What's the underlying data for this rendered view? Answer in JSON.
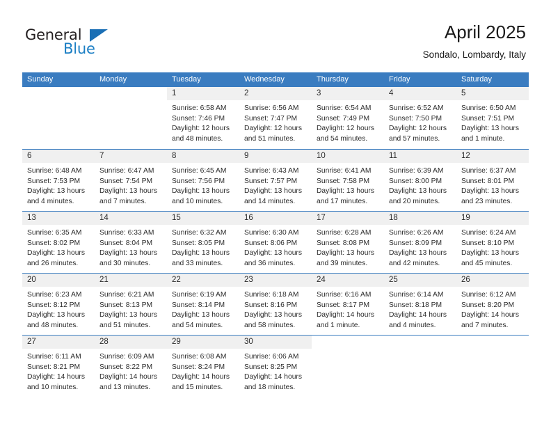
{
  "brand": {
    "name_part1": "General",
    "name_part2": "Blue",
    "color_dark": "#231f20",
    "color_blue": "#1c7fc4"
  },
  "header": {
    "title": "April 2025",
    "subtitle": "Sondalo, Lombardy, Italy"
  },
  "theme": {
    "header_bar": "#3a7cc0",
    "daynum_band": "#f0f0f0",
    "text": "#2b2b2b"
  },
  "weekdays": [
    "Sunday",
    "Monday",
    "Tuesday",
    "Wednesday",
    "Thursday",
    "Friday",
    "Saturday"
  ],
  "weeks": [
    [
      {
        "day": "",
        "lines": [
          "",
          "",
          "",
          ""
        ]
      },
      {
        "day": "",
        "lines": [
          "",
          "",
          "",
          ""
        ]
      },
      {
        "day": "1",
        "lines": [
          "Sunrise: 6:58 AM",
          "Sunset: 7:46 PM",
          "Daylight: 12 hours",
          "and 48 minutes."
        ]
      },
      {
        "day": "2",
        "lines": [
          "Sunrise: 6:56 AM",
          "Sunset: 7:47 PM",
          "Daylight: 12 hours",
          "and 51 minutes."
        ]
      },
      {
        "day": "3",
        "lines": [
          "Sunrise: 6:54 AM",
          "Sunset: 7:49 PM",
          "Daylight: 12 hours",
          "and 54 minutes."
        ]
      },
      {
        "day": "4",
        "lines": [
          "Sunrise: 6:52 AM",
          "Sunset: 7:50 PM",
          "Daylight: 12 hours",
          "and 57 minutes."
        ]
      },
      {
        "day": "5",
        "lines": [
          "Sunrise: 6:50 AM",
          "Sunset: 7:51 PM",
          "Daylight: 13 hours",
          "and 1 minute."
        ]
      }
    ],
    [
      {
        "day": "6",
        "lines": [
          "Sunrise: 6:48 AM",
          "Sunset: 7:53 PM",
          "Daylight: 13 hours",
          "and 4 minutes."
        ]
      },
      {
        "day": "7",
        "lines": [
          "Sunrise: 6:47 AM",
          "Sunset: 7:54 PM",
          "Daylight: 13 hours",
          "and 7 minutes."
        ]
      },
      {
        "day": "8",
        "lines": [
          "Sunrise: 6:45 AM",
          "Sunset: 7:56 PM",
          "Daylight: 13 hours",
          "and 10 minutes."
        ]
      },
      {
        "day": "9",
        "lines": [
          "Sunrise: 6:43 AM",
          "Sunset: 7:57 PM",
          "Daylight: 13 hours",
          "and 14 minutes."
        ]
      },
      {
        "day": "10",
        "lines": [
          "Sunrise: 6:41 AM",
          "Sunset: 7:58 PM",
          "Daylight: 13 hours",
          "and 17 minutes."
        ]
      },
      {
        "day": "11",
        "lines": [
          "Sunrise: 6:39 AM",
          "Sunset: 8:00 PM",
          "Daylight: 13 hours",
          "and 20 minutes."
        ]
      },
      {
        "day": "12",
        "lines": [
          "Sunrise: 6:37 AM",
          "Sunset: 8:01 PM",
          "Daylight: 13 hours",
          "and 23 minutes."
        ]
      }
    ],
    [
      {
        "day": "13",
        "lines": [
          "Sunrise: 6:35 AM",
          "Sunset: 8:02 PM",
          "Daylight: 13 hours",
          "and 26 minutes."
        ]
      },
      {
        "day": "14",
        "lines": [
          "Sunrise: 6:33 AM",
          "Sunset: 8:04 PM",
          "Daylight: 13 hours",
          "and 30 minutes."
        ]
      },
      {
        "day": "15",
        "lines": [
          "Sunrise: 6:32 AM",
          "Sunset: 8:05 PM",
          "Daylight: 13 hours",
          "and 33 minutes."
        ]
      },
      {
        "day": "16",
        "lines": [
          "Sunrise: 6:30 AM",
          "Sunset: 8:06 PM",
          "Daylight: 13 hours",
          "and 36 minutes."
        ]
      },
      {
        "day": "17",
        "lines": [
          "Sunrise: 6:28 AM",
          "Sunset: 8:08 PM",
          "Daylight: 13 hours",
          "and 39 minutes."
        ]
      },
      {
        "day": "18",
        "lines": [
          "Sunrise: 6:26 AM",
          "Sunset: 8:09 PM",
          "Daylight: 13 hours",
          "and 42 minutes."
        ]
      },
      {
        "day": "19",
        "lines": [
          "Sunrise: 6:24 AM",
          "Sunset: 8:10 PM",
          "Daylight: 13 hours",
          "and 45 minutes."
        ]
      }
    ],
    [
      {
        "day": "20",
        "lines": [
          "Sunrise: 6:23 AM",
          "Sunset: 8:12 PM",
          "Daylight: 13 hours",
          "and 48 minutes."
        ]
      },
      {
        "day": "21",
        "lines": [
          "Sunrise: 6:21 AM",
          "Sunset: 8:13 PM",
          "Daylight: 13 hours",
          "and 51 minutes."
        ]
      },
      {
        "day": "22",
        "lines": [
          "Sunrise: 6:19 AM",
          "Sunset: 8:14 PM",
          "Daylight: 13 hours",
          "and 54 minutes."
        ]
      },
      {
        "day": "23",
        "lines": [
          "Sunrise: 6:18 AM",
          "Sunset: 8:16 PM",
          "Daylight: 13 hours",
          "and 58 minutes."
        ]
      },
      {
        "day": "24",
        "lines": [
          "Sunrise: 6:16 AM",
          "Sunset: 8:17 PM",
          "Daylight: 14 hours",
          "and 1 minute."
        ]
      },
      {
        "day": "25",
        "lines": [
          "Sunrise: 6:14 AM",
          "Sunset: 8:18 PM",
          "Daylight: 14 hours",
          "and 4 minutes."
        ]
      },
      {
        "day": "26",
        "lines": [
          "Sunrise: 6:12 AM",
          "Sunset: 8:20 PM",
          "Daylight: 14 hours",
          "and 7 minutes."
        ]
      }
    ],
    [
      {
        "day": "27",
        "lines": [
          "Sunrise: 6:11 AM",
          "Sunset: 8:21 PM",
          "Daylight: 14 hours",
          "and 10 minutes."
        ]
      },
      {
        "day": "28",
        "lines": [
          "Sunrise: 6:09 AM",
          "Sunset: 8:22 PM",
          "Daylight: 14 hours",
          "and 13 minutes."
        ]
      },
      {
        "day": "29",
        "lines": [
          "Sunrise: 6:08 AM",
          "Sunset: 8:24 PM",
          "Daylight: 14 hours",
          "and 15 minutes."
        ]
      },
      {
        "day": "30",
        "lines": [
          "Sunrise: 6:06 AM",
          "Sunset: 8:25 PM",
          "Daylight: 14 hours",
          "and 18 minutes."
        ]
      },
      {
        "day": "",
        "lines": [
          "",
          "",
          "",
          ""
        ]
      },
      {
        "day": "",
        "lines": [
          "",
          "",
          "",
          ""
        ]
      },
      {
        "day": "",
        "lines": [
          "",
          "",
          "",
          ""
        ]
      }
    ]
  ]
}
